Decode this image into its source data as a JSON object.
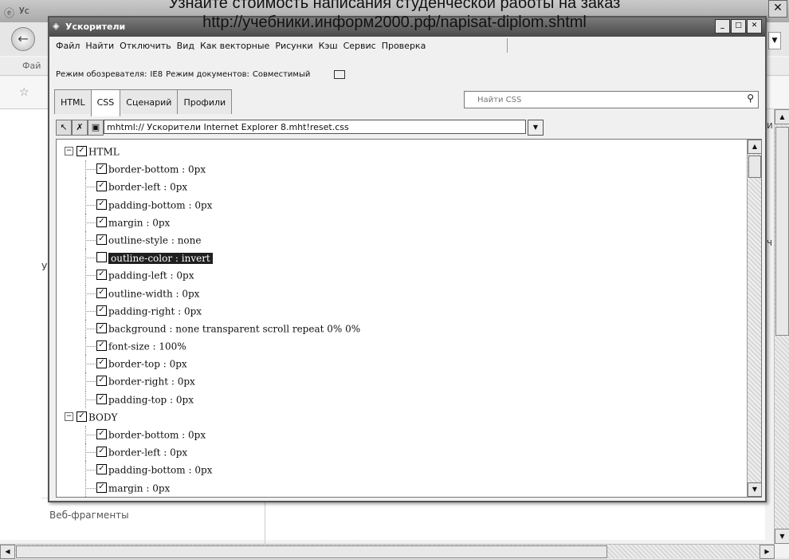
{
  "watermark": {
    "line1": "Узнайте стоимость написания студенческой работы на заказ",
    "line2": "http://учебники.информ2000.рф/napisat-diplom.shtml"
  },
  "background_browser": {
    "title": "Ус",
    "menu_item": "Фай",
    "close_glyph": "✕",
    "side_frag_right_1": "и",
    "side_frag_right_2": "ч",
    "side_frag_left": "У",
    "web_fragments": "Веб-фрагменты"
  },
  "devtools": {
    "title": "Ускорители",
    "window_buttons": [
      "_",
      "□",
      "✕"
    ],
    "menu": [
      "Файл",
      "Найти",
      "Отключить",
      "Вид",
      "Как векторные",
      "Рисунки",
      "Кэш",
      "Сервис",
      "Проверка"
    ],
    "browser_mode_label": "Режим обозревателя:",
    "browser_mode_value": "IE8",
    "document_mode_label": "Режим документов:",
    "document_mode_value": "Совместимый",
    "tabs": [
      "HTML",
      "CSS",
      "Сценарий",
      "Профили"
    ],
    "active_tab": "CSS",
    "search_placeholder": "Найти CSS",
    "url": "mhtml:// Ускорители Internet Explorer 8.mht!reset.css",
    "tree": [
      {
        "type": "group",
        "label": "HTML",
        "checked": true
      },
      {
        "type": "prop",
        "label": "border-bottom : 0px",
        "checked": true
      },
      {
        "type": "prop",
        "label": "border-left : 0px",
        "checked": true
      },
      {
        "type": "prop",
        "label": "padding-bottom : 0px",
        "checked": true
      },
      {
        "type": "prop",
        "label": "margin : 0px",
        "checked": true
      },
      {
        "type": "prop",
        "label": "outline-style : none",
        "checked": true
      },
      {
        "type": "prop",
        "label": "outline-color : invert",
        "checked": false,
        "selected": true
      },
      {
        "type": "prop",
        "label": "padding-left : 0px",
        "checked": true
      },
      {
        "type": "prop",
        "label": "outline-width : 0px",
        "checked": true
      },
      {
        "type": "prop",
        "label": "padding-right : 0px",
        "checked": true
      },
      {
        "type": "prop",
        "label": "background : none transparent scroll repeat 0% 0%",
        "checked": true
      },
      {
        "type": "prop",
        "label": "font-size : 100%",
        "checked": true
      },
      {
        "type": "prop",
        "label": "border-top : 0px",
        "checked": true
      },
      {
        "type": "prop",
        "label": "border-right : 0px",
        "checked": true
      },
      {
        "type": "prop",
        "label": "padding-top : 0px",
        "checked": true
      },
      {
        "type": "group",
        "label": "BODY",
        "checked": true
      },
      {
        "type": "prop",
        "label": "border-bottom : 0px",
        "checked": true
      },
      {
        "type": "prop",
        "label": "border-left : 0px",
        "checked": true
      },
      {
        "type": "prop",
        "label": "padding-bottom : 0px",
        "checked": true
      },
      {
        "type": "prop",
        "label": "margin : 0px",
        "checked": true
      }
    ]
  }
}
